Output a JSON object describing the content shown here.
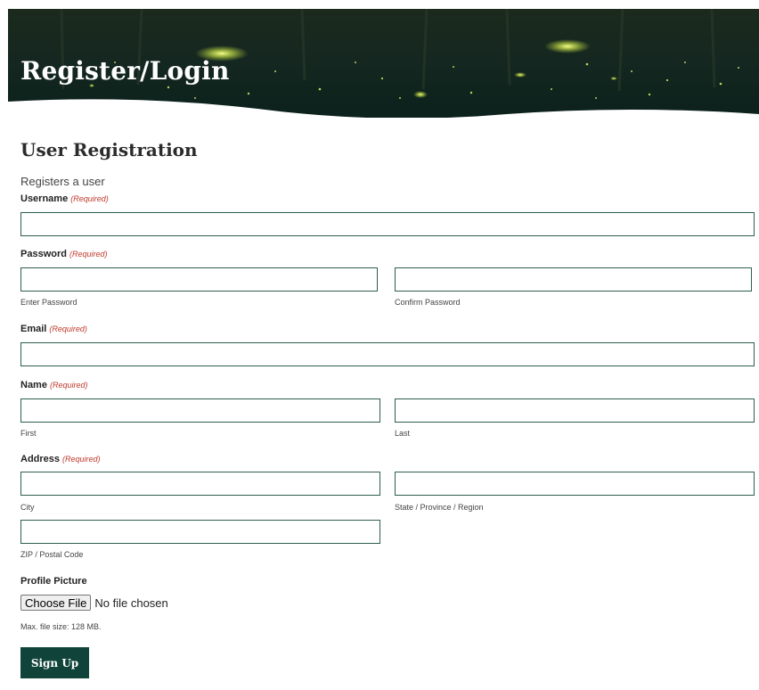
{
  "hero": {
    "title": "Register/Login"
  },
  "form": {
    "title": "User Registration",
    "description": "Registers a user",
    "required_label": "(Required)",
    "username": {
      "label": "Username",
      "value": ""
    },
    "password": {
      "label": "Password",
      "enter_sublabel": "Enter Password",
      "confirm_sublabel": "Confirm Password",
      "enter_value": "",
      "confirm_value": ""
    },
    "email": {
      "label": "Email",
      "value": ""
    },
    "name": {
      "label": "Name",
      "first_sublabel": "First",
      "last_sublabel": "Last",
      "first_value": "",
      "last_value": ""
    },
    "address": {
      "label": "Address",
      "city_sublabel": "City",
      "state_sublabel": "State / Province / Region",
      "zip_sublabel": "ZIP / Postal Code",
      "city_value": "",
      "state_value": "",
      "zip_value": ""
    },
    "profile_picture": {
      "label": "Profile Picture",
      "button_label": "Choose File",
      "status": "No file chosen",
      "max_size": "Max. file size: 128 MB."
    },
    "submit_label": "Sign Up"
  },
  "colors": {
    "banner": "#0f2a22",
    "input_border": "#2f5d4e",
    "required": "#c0392b",
    "button": "#10443a"
  }
}
